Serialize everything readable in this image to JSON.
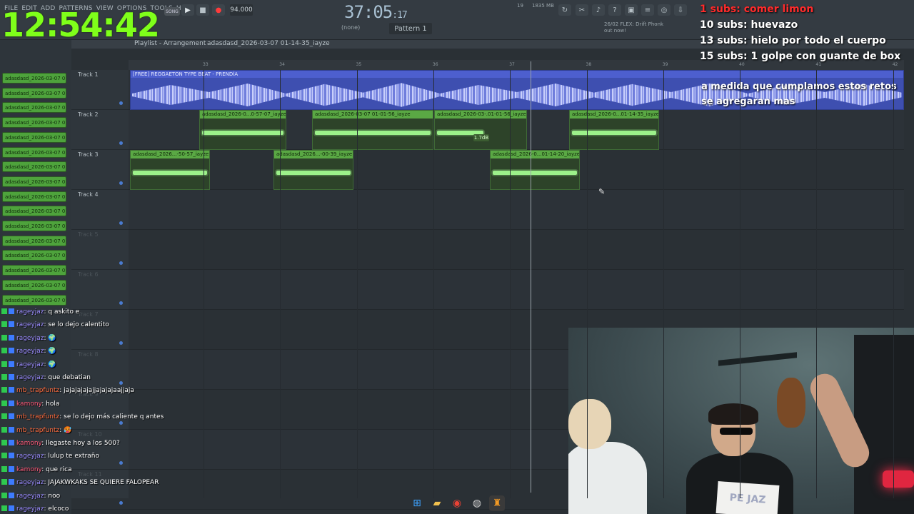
{
  "menu": [
    "FILE",
    "EDIT",
    "ADD",
    "PATTERNS",
    "VIEW",
    "OPTIONS",
    "TOOLS",
    "HELP"
  ],
  "clock": "12:54:42",
  "transport": {
    "song_label": "SONG",
    "tempo": "94.000",
    "time_main": "37:05",
    "time_sub": ":17",
    "play": "▶",
    "stop": "■",
    "record": "●"
  },
  "toolbar": {
    "pattern": "Pattern 1",
    "none": "(none)",
    "memory": "1835 MB",
    "cpu": "19",
    "flex_line1": "26/02  FLEX: Drift Phonk",
    "flex_line2": "out now!"
  },
  "playlist": {
    "title": "Playlist - Arrangement",
    "file": "adasdasd_2026-03-07 01-14-35_iayze"
  },
  "ruler": [
    "33",
    "34",
    "35",
    "36",
    "37",
    "38",
    "39",
    "40",
    "41",
    "42"
  ],
  "tracks": [
    "Track 1",
    "Track 2",
    "Track 3",
    "Track 4",
    "Track 5",
    "Track 6",
    "Track 7",
    "Track 8",
    "Track 9",
    "Track 10",
    "Track 11"
  ],
  "browser_items": [
    "adasdasd_2026-03-07 0...",
    "adasdasd_2026-03-07 0...",
    "adasdasd_2026-03-07 0...",
    "adasdasd_2026-03-07 0...",
    "adasdasd_2026-03-07 0...",
    "adasdasd_2026-03-07 0...",
    "adasdasd_2026-03-07 0...",
    "adasdasd_2026-03-07 0...",
    "adasdasd_2026-03-07 0...",
    "adasdasd_2026-03-07 0...",
    "adasdasd_2026-03-07 0...",
    "adasdasd_2026-03-07 0...",
    "adasdasd_2026-03-07 0...",
    "adasdasd_2026-03-07 0...",
    "adasdasd_2026-03-07 0...",
    "adasdasd_2026-03-07 0..."
  ],
  "clips": {
    "beat": "[FREE] REGGAETON TYPE BEAT - PRENDÍA",
    "t2": [
      "adasdasd_2026-0...0-57-07_iayze",
      "adasdasd_2026-03-07 01-01-56_iayze",
      "adasdasd_2026-03-.01-01-56_iayze",
      "adasdasd_2026-0...01-14-35_iayze"
    ],
    "t3": [
      "adasdasd_2026...-50-57_iayze",
      "adasdasd_2026...-00-39_iayze",
      "adasdasd_2026-0...01-14-20_iayze"
    ],
    "db": "1.7dB"
  },
  "goals": {
    "g1": "1 subs: comer limon",
    "g2": "10 subs: huevazo",
    "g3": "13 subs: hielo por todo el cuerpo",
    "g4": "15 subs: 1 golpe con guante de box",
    "note": "a medida que cumplamos estos retos se agregaran mas"
  },
  "chat": [
    {
      "user": "rageyjaz",
      "text": ": q askito e"
    },
    {
      "user": "rageyjaz",
      "text": ": se lo dejo calentito"
    },
    {
      "user": "rageyjaz",
      "text": ": 🌍"
    },
    {
      "user": "rageyjaz",
      "text": ": 🌍"
    },
    {
      "user": "rageyjaz",
      "text": ": 🌍"
    },
    {
      "user": "rageyjaz",
      "text": ": que debatian"
    },
    {
      "user": "mb_trapfuntz",
      "text": ": jajajajajajjajajajaajjaja"
    },
    {
      "user": "kamony",
      "text": ": hola"
    },
    {
      "user": "mb_trapfuntz",
      "text": ": se lo dejo más caliente q antes"
    },
    {
      "user": "mb_trapfuntz",
      "text": ": 🥵"
    },
    {
      "user": "kamony",
      "text": ": llegaste hoy a los 500?"
    },
    {
      "user": "rageyjaz",
      "text": ": lulup te extraño"
    },
    {
      "user": "kamony",
      "text": ": que rica"
    },
    {
      "user": "rageyjaz",
      "text": ": JAJAKWKAKS SE QUIERE FALOPEAR"
    },
    {
      "user": "rageyjaz",
      "text": ": noo"
    },
    {
      "user": "rageyjaz",
      "text": ": elcoco"
    }
  ],
  "cam": {
    "sign": "PE JAZ"
  },
  "taskbar": [
    "windows-icon",
    "folder-icon",
    "chrome-icon",
    "obs-icon",
    "fl-studio-icon"
  ],
  "colors": {
    "clock": "#7fff1a",
    "goal_red": "#ff2b2b",
    "clip_green": "#5aa844",
    "beat_blue": "#3e4fb0"
  }
}
